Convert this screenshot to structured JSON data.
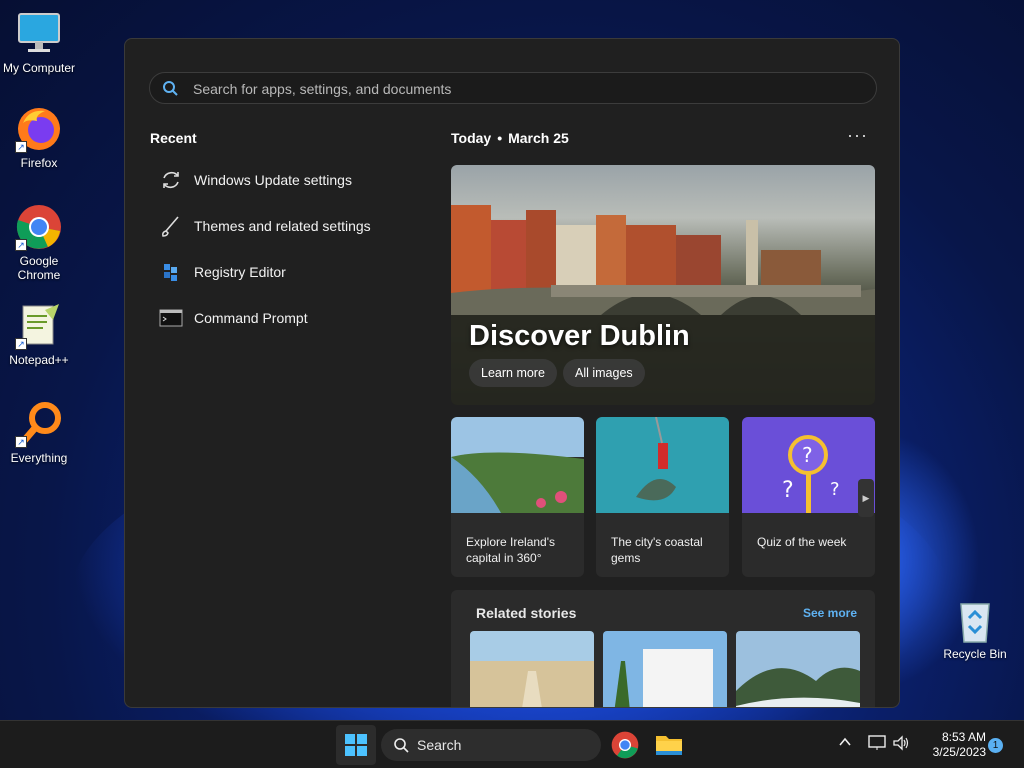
{
  "desktop": {
    "icons": [
      {
        "label": "My Computer",
        "icon": "monitor-icon"
      },
      {
        "label": "Firefox",
        "icon": "firefox-icon"
      },
      {
        "label": "Google Chrome",
        "icon": "chrome-icon"
      },
      {
        "label": "Notepad++",
        "icon": "notepadpp-icon"
      },
      {
        "label": "Everything",
        "icon": "everything-icon"
      },
      {
        "label": "Recycle Bin",
        "icon": "recycle-bin-icon"
      }
    ]
  },
  "start_menu": {
    "search": {
      "placeholder": "Search for apps, settings, and documents"
    },
    "recent": {
      "title": "Recent",
      "items": [
        {
          "label": "Windows Update settings",
          "icon": "refresh-icon"
        },
        {
          "label": "Themes and related settings",
          "icon": "brush-icon"
        },
        {
          "label": "Registry Editor",
          "icon": "registry-icon"
        },
        {
          "label": "Command Prompt",
          "icon": "terminal-icon"
        }
      ]
    },
    "today": {
      "label": "Today",
      "date": "March 25",
      "more_icon": "ellipsis-icon"
    },
    "hero": {
      "title": "Discover Dublin",
      "buttons": [
        "Learn more",
        "All images"
      ]
    },
    "cards": [
      {
        "caption": "Explore Ireland's capital in 360°"
      },
      {
        "caption": "The city's coastal gems"
      },
      {
        "caption": "Quiz of the week"
      }
    ],
    "related": {
      "title": "Related stories",
      "see_more": "See more"
    }
  },
  "taskbar": {
    "search_label": "Search",
    "apps": [
      "windows-start-icon",
      "chrome-icon",
      "file-explorer-icon"
    ],
    "tray_icons": [
      "chevron-up-icon",
      "network-icon",
      "volume-icon"
    ],
    "time": "8:53 AM",
    "date": "3/25/2023",
    "notification_count": "1"
  },
  "colors": {
    "panel_bg": "#202020",
    "accent": "#5fb2f2",
    "taskbar_bg": "#1c1c1c"
  }
}
